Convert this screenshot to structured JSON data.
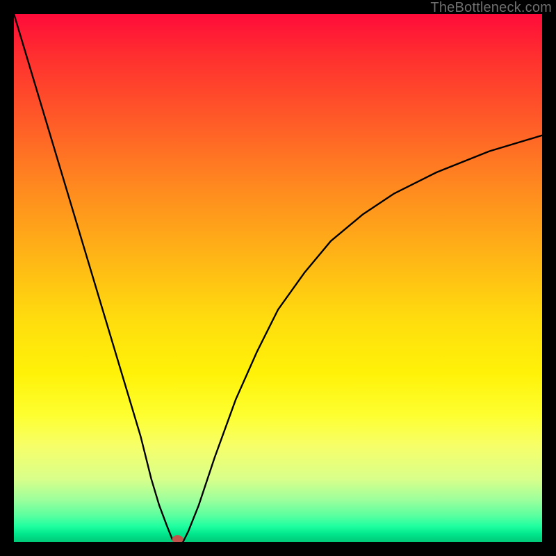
{
  "watermark": "TheBottleneck.com",
  "chart_data": {
    "type": "line",
    "title": "",
    "xlabel": "",
    "ylabel": "",
    "xlim": [
      0,
      100
    ],
    "ylim": [
      0,
      100
    ],
    "grid": false,
    "legend": false,
    "series": [
      {
        "name": "bottleneck-curve",
        "color": "#000000",
        "x": [
          0,
          3,
          6,
          9,
          12,
          15,
          18,
          21,
          24,
          26,
          27.5,
          29,
          30,
          31,
          32,
          33,
          35,
          38,
          42,
          46,
          50,
          55,
          60,
          66,
          72,
          80,
          90,
          100
        ],
        "values": [
          100,
          90,
          80,
          70,
          60,
          50,
          40,
          30,
          20,
          12,
          7,
          3,
          0.5,
          0,
          0,
          2,
          7,
          16,
          27,
          36,
          44,
          51,
          57,
          62,
          66,
          70,
          74,
          77
        ]
      }
    ],
    "marker": {
      "name": "bottleneck-point",
      "x": 31,
      "y": 0,
      "color": "#c0544c"
    }
  }
}
